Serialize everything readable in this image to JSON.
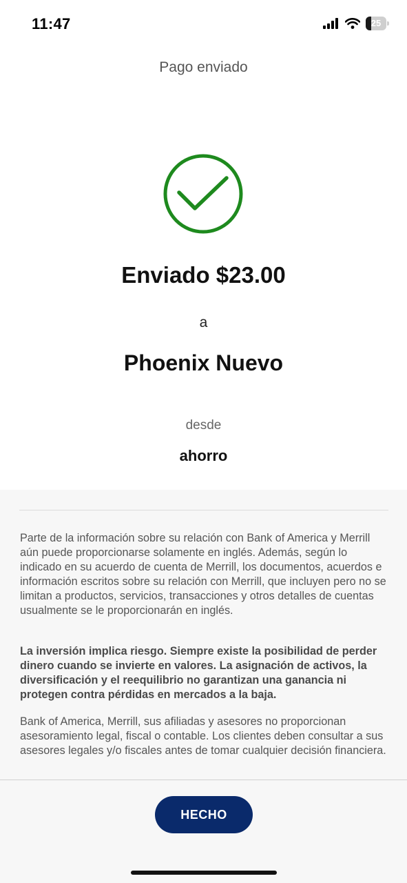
{
  "status_bar": {
    "time": "11:47",
    "battery_percent": "25",
    "battery_level": 0.25,
    "icons": [
      "signal-icon",
      "wifi-icon",
      "battery-icon"
    ]
  },
  "header": {
    "title": "Pago enviado"
  },
  "confirmation": {
    "icon": "check-circle-icon",
    "icon_color": "#1e8a1e",
    "sent_text": "Enviado $23.00",
    "to_label": "a",
    "recipient": "Phoenix Nuevo",
    "from_label": "desde",
    "account": "ahorro"
  },
  "disclosures": {
    "paragraph_1": "Parte de la información sobre su relación con Bank of America y Merrill aún puede proporcionarse solamente en inglés. Además, según lo indicado en su acuerdo de cuenta de Merrill, los documentos, acuerdos e información escritos sobre su relación con Merrill, que incluyen pero no se limitan a productos, servicios, transacciones y otros detalles de cuentas usualmente se le proporcionarán en inglés.",
    "paragraph_2": "La inversión implica riesgo. Siempre existe la posibilidad de perder dinero cuando se invierte en valores. La asignación de activos, la diversificación y el reequilibrio no garantizan una ganancia ni protegen contra pérdidas en mercados a la baja.",
    "paragraph_3": "Bank of America, Merrill, sus afiliadas y asesores no proporcionan asesoramiento legal, fiscal o contable. Los clientes deben consultar a sus asesores legales y/o fiscales antes de tomar cualquier decisión financiera."
  },
  "footer": {
    "done_label": "HECHO",
    "button_color": "#0a2a6b"
  }
}
